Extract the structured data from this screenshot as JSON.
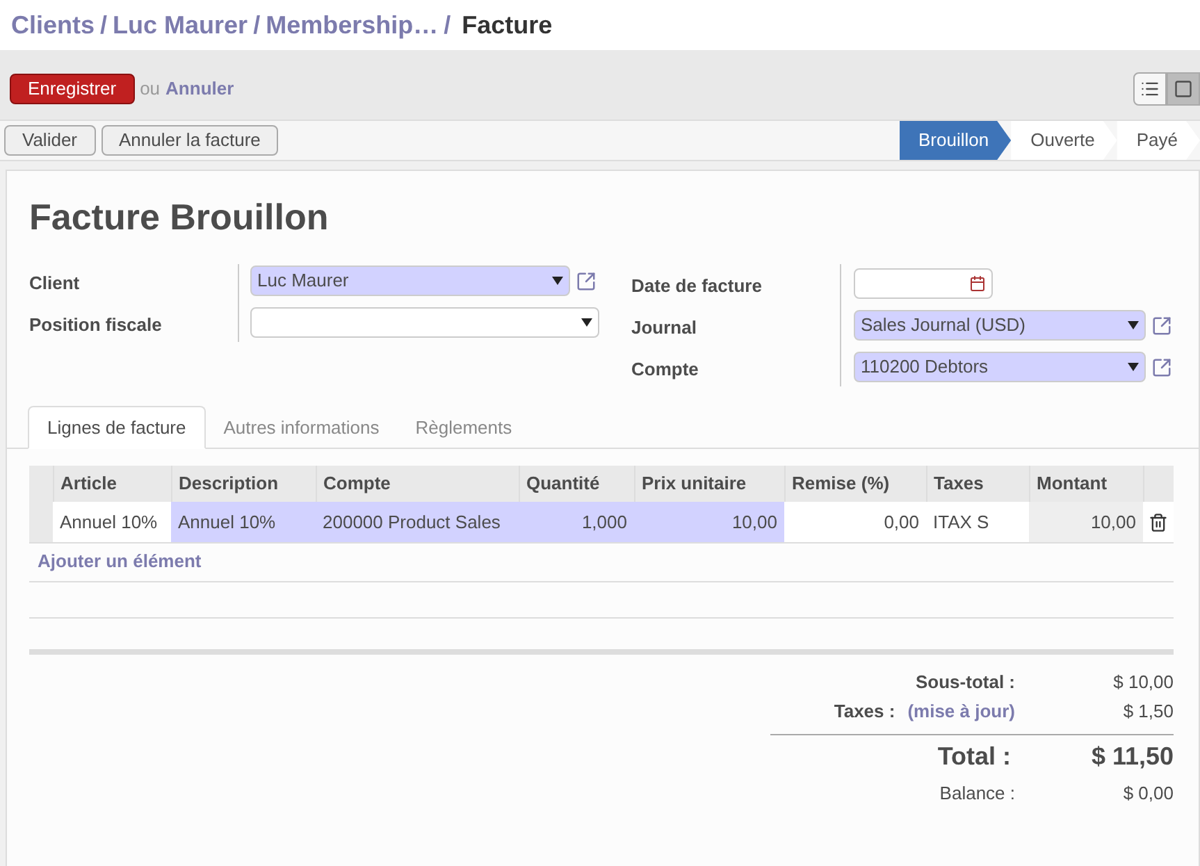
{
  "breadcrumb_separator": "/",
  "breadcrumbs": [
    {
      "label": "Clients",
      "kind": "link"
    },
    {
      "label": "Luc Maurer",
      "kind": "link"
    },
    {
      "label": "Membership…",
      "kind": "link"
    },
    {
      "label": "Facture",
      "kind": "current"
    }
  ],
  "actions": {
    "save": "Enregistrer",
    "or": "ou",
    "cancel": "Annuler"
  },
  "view_switcher": [
    {
      "kind": "list",
      "selected": false
    },
    {
      "kind": "form",
      "selected": true
    }
  ],
  "header_buttons": [
    "Valider",
    "Annuler la facture"
  ],
  "stages": [
    {
      "label": "Brouillon",
      "selected": true
    },
    {
      "label": "Ouverte",
      "selected": false
    },
    {
      "label": "Payé",
      "selected": false
    }
  ],
  "title": "Facture Brouillon",
  "fields_left": [
    {
      "label": "Client",
      "kind": "select",
      "value": "Luc Maurer",
      "required": true,
      "external_link": true
    },
    {
      "label": "Position fiscale",
      "kind": "select",
      "required": false,
      "external_link": false
    }
  ],
  "fields_right": [
    {
      "label": "Date de facture",
      "kind": "date",
      "required": false
    },
    {
      "label": "Journal",
      "kind": "select",
      "value": "Sales Journal (USD)",
      "required": true,
      "external_link": true
    },
    {
      "label": "Compte",
      "kind": "select",
      "value": "110200 Debtors",
      "required": true,
      "external_link": true
    }
  ],
  "tabs": [
    {
      "label": "Lignes de facture",
      "selected": true
    },
    {
      "label": "Autres informations",
      "selected": false
    },
    {
      "label": "Règlements",
      "selected": false
    }
  ],
  "table": {
    "columns": [
      {
        "label": "Article",
        "kind": "plain",
        "numeric": false
      },
      {
        "label": "Description",
        "kind": "required",
        "numeric": false
      },
      {
        "label": "Compte",
        "kind": "required",
        "numeric": false
      },
      {
        "label": "Quantité",
        "kind": "required",
        "numeric": true
      },
      {
        "label": "Prix unitaire",
        "kind": "required",
        "numeric": true
      },
      {
        "label": "Remise (%)",
        "kind": "plain",
        "numeric": true
      },
      {
        "label": "Taxes",
        "kind": "plain",
        "numeric": false
      },
      {
        "label": "Montant",
        "kind": "readonly",
        "numeric": true
      }
    ],
    "rows": [
      [
        "Annuel 10%",
        "Annuel 10%",
        "200000 Product Sales",
        "1,000",
        "10,00",
        "0,00",
        "ITAX S",
        "10,00"
      ]
    ],
    "add_item": "Ajouter un élément"
  },
  "totals": {
    "subtotal_label": "Sous-total :",
    "subtotal": "$ 10,00",
    "taxes_label": "Taxes :",
    "update_link": "(mise à jour)",
    "taxes": "$ 1,50",
    "total_label": "Total :",
    "total": "$ 11,50",
    "balance_label": "Balance :",
    "balance": "$ 0,00"
  }
}
